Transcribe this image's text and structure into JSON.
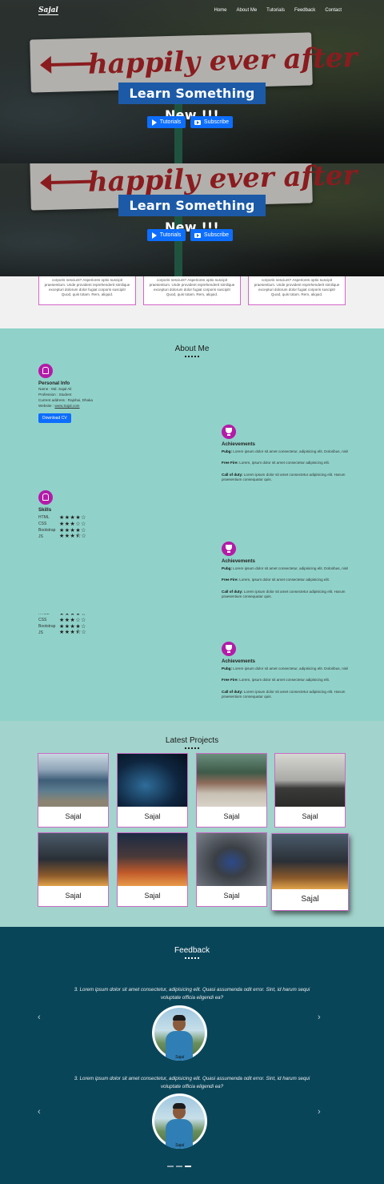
{
  "nav": {
    "logo": "Sajal",
    "links": [
      "Home",
      "About Me",
      "Tutorials",
      "Feedback",
      "Contact"
    ]
  },
  "hero": {
    "sign_text": "happily ever after",
    "title": "Learn Something New !!!",
    "btn_tutorials": "Tutorials",
    "btn_subscribe": "Subscribe"
  },
  "cards": {
    "text": "corporis nesciunt? Asperiores optio suscipit praesentium. Unde provident reprehenderit similique excepturi dolorum dolor fugiat corporis suscipit! Quod, quis totam. Rem, aliquid."
  },
  "about": {
    "title": "About Me",
    "personal": {
      "title": "Personal Info",
      "name": "Name : Md. Sajal Ali",
      "profession": "Profession : Student",
      "address": "Current address : Rajshai, Dhaka",
      "website_label": "Website :",
      "website": "www.Sajal.com",
      "cv_button": "Download CV"
    },
    "skills": {
      "title": "Skills",
      "items": [
        {
          "name": "HTML",
          "stars": "★★★★☆"
        },
        {
          "name": "CSS",
          "stars": "★★★☆☆"
        },
        {
          "name": "Bootstrap",
          "stars": "★★★★☆"
        },
        {
          "name": "JS",
          "stars": "★★★⯪☆"
        }
      ]
    },
    "achievements": {
      "title": "Achievements",
      "pubg_label": "Pubg:",
      "pubg": "Lorem ipsum dolor sit amet consectetur, adipisicing elit. Doloribus, nisi!",
      "freefire_label": "Free Fire:",
      "freefire": "Lorem, ipsum dolor sit amet consectetur adipisicing elit.",
      "cod_label": "Call of duty:",
      "cod": "Lorem ipsum dolor sit amet consectetur adipisicing elit. Harum praesentium consequatur quis."
    }
  },
  "projects": {
    "title": "Latest Projects",
    "caption": "Sajal"
  },
  "feedback": {
    "title": "Feedback",
    "quote": "3. Lorem ipsum dolor sit amet consectetur, adipisicing elit. Quasi assumenda odit error. Sint, id harum sequi voluptate officia eligendi ea?",
    "name": "Sajal"
  },
  "colors": {
    "accent": "#b31ba8",
    "primary_button": "#0d6efd",
    "about_bg": "#90d2c9",
    "projects_bg": "#a2d3cc",
    "feedback_bg": "#094559"
  }
}
